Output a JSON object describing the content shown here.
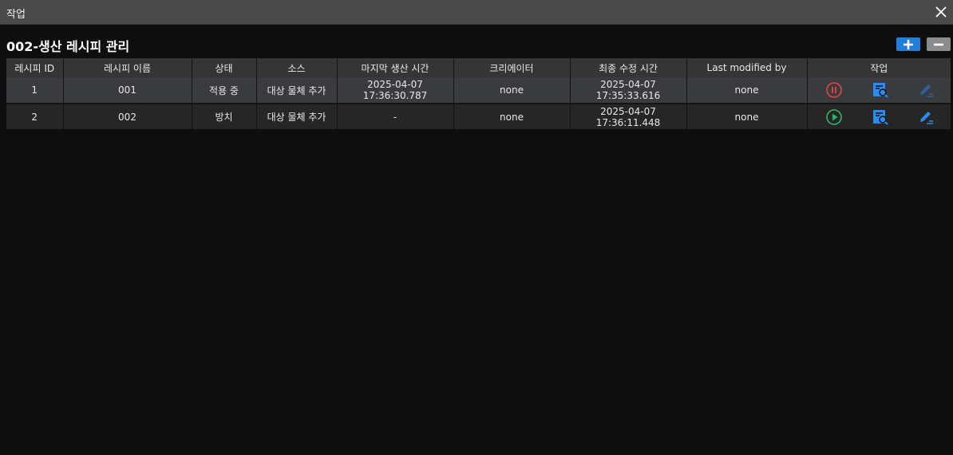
{
  "window": {
    "title": "작업",
    "close_icon": "close-icon"
  },
  "page": {
    "title": "002-생산 레시피 관리"
  },
  "toolbar": {
    "add_icon": "plus-icon",
    "remove_icon": "minus-icon",
    "add_color": "#1f7fe0",
    "remove_color": "#8c8c8c"
  },
  "table": {
    "headers": [
      "레시피 ID",
      "레시피 이름",
      "상태",
      "소스",
      "마지막 생산 시간",
      "크리에이터",
      "최종 수정 시간",
      "Last modified by",
      "작업"
    ],
    "rows": [
      {
        "id": "1",
        "name": "001",
        "status": "적용 중",
        "source": "대상 물체 추가",
        "last_production": "2025-04-07 17:36:30.787",
        "creator": "none",
        "modified": "2025-04-07 17:35:33.616",
        "modified_by": "none",
        "actions": [
          "pause-icon",
          "view-icon",
          "edit-icon"
        ]
      },
      {
        "id": "2",
        "name": "002",
        "status": "방치",
        "source": "대상 물체 추가",
        "last_production": "-",
        "creator": "none",
        "modified": "2025-04-07 17:36:11.448",
        "modified_by": "none",
        "actions": [
          "play-icon",
          "view-icon",
          "edit-icon"
        ]
      }
    ]
  },
  "colors": {
    "active_status": "#3fba72",
    "pause": "#e04646",
    "play": "#2fb46a",
    "action_blue": "#2a8bf0"
  }
}
